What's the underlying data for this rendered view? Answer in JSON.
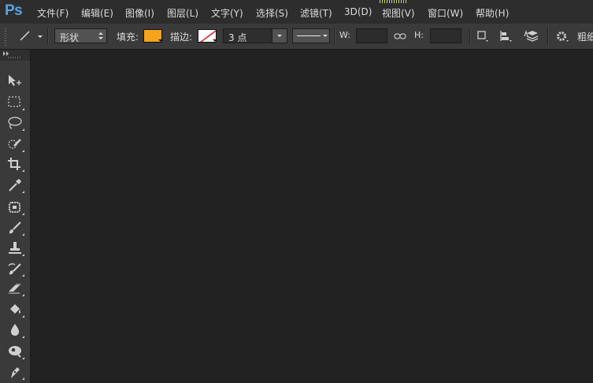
{
  "app": {
    "logo": "Ps"
  },
  "menu": {
    "items": [
      "文件(F)",
      "编辑(E)",
      "图像(I)",
      "图层(L)",
      "文字(Y)",
      "选择(S)",
      "滤镜(T)",
      "3D(D)",
      "视图(V)",
      "窗口(W)",
      "帮助(H)"
    ]
  },
  "options": {
    "mode": "形状",
    "fill_label": "填充:",
    "fill_color": "#f7a41d",
    "stroke_label": "描边:",
    "stroke_size": "3 点",
    "width_label": "W:",
    "height_label": "H:",
    "weight_label": "粗细"
  },
  "tools": [
    "move-tool",
    "marquee-tool",
    "lasso-tool",
    "quick-selection-tool",
    "crop-tool",
    "eyedropper-tool",
    "spot-healing-tool",
    "brush-tool",
    "clone-stamp-tool",
    "history-brush-tool",
    "eraser-tool",
    "paint-bucket-tool",
    "blur-tool",
    "dodge-tool",
    "pen-tool"
  ]
}
